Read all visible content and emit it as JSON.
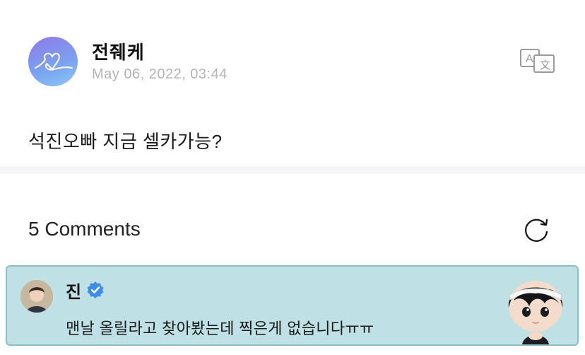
{
  "post": {
    "author": "전줴케",
    "timestamp": "May 06, 2022, 03:44",
    "body": "석진오빠 지금 셀카가능?",
    "avatar_icon": "heart-doodle-icon",
    "translate_icon": "translate-icon"
  },
  "comments": {
    "header": "5 Comments",
    "refresh_icon": "refresh-icon",
    "items": [
      {
        "author": "진",
        "verified": true,
        "text": "맨날 올릴라고 찾아봤는데 찍은게 없습니다ㅠㅠ",
        "background": "#bfe0e4",
        "accent": "#8bbfc8"
      }
    ]
  },
  "colors": {
    "verified_blue": "#3b8de8",
    "timestamp_gray": "#b4b4b8",
    "divider": "#f5f5f7"
  }
}
